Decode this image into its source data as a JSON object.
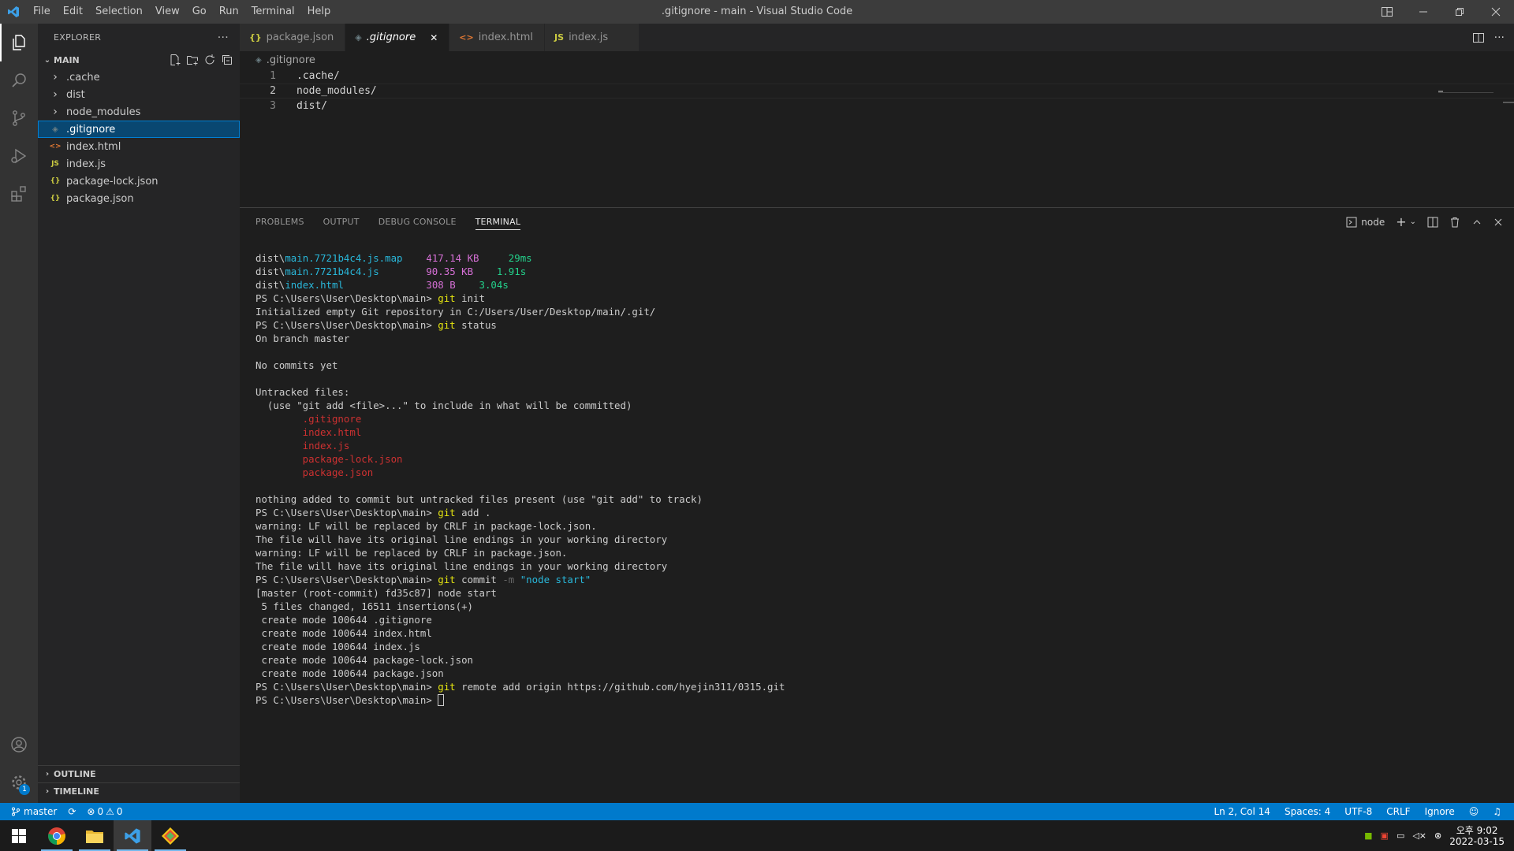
{
  "window": {
    "title": ".gitignore - main - Visual Studio Code",
    "menu": [
      "File",
      "Edit",
      "Selection",
      "View",
      "Go",
      "Run",
      "Terminal",
      "Help"
    ]
  },
  "sidebar": {
    "title": "EXPLORER",
    "section": "MAIN",
    "items": [
      {
        "label": ".cache",
        "type": "folder"
      },
      {
        "label": "dist",
        "type": "folder"
      },
      {
        "label": "node_modules",
        "type": "folder"
      },
      {
        "label": ".gitignore",
        "type": "gitignore",
        "selected": true
      },
      {
        "label": "index.html",
        "type": "html"
      },
      {
        "label": "index.js",
        "type": "js"
      },
      {
        "label": "package-lock.json",
        "type": "json"
      },
      {
        "label": "package.json",
        "type": "json"
      }
    ],
    "outline": "OUTLINE",
    "timeline": "TIMELINE"
  },
  "tabs": [
    {
      "label": "package.json",
      "icon": "{}",
      "active": false
    },
    {
      "label": ".gitignore",
      "icon": "◈",
      "active": true
    },
    {
      "label": "index.html",
      "icon": "<>",
      "active": false
    },
    {
      "label": "index.js",
      "icon": "JS",
      "active": false
    }
  ],
  "breadcrumb": ".gitignore",
  "code": [
    {
      "n": "1",
      "text": ".cache/"
    },
    {
      "n": "2",
      "text": "node_modules/"
    },
    {
      "n": "3",
      "text": "dist/"
    }
  ],
  "panel": {
    "tabs": [
      "PROBLEMS",
      "OUTPUT",
      "DEBUG CONSOLE",
      "TERMINAL"
    ],
    "active": "TERMINAL",
    "terminal_name": "node"
  },
  "terminal": [
    [
      [
        "dist\\",
        ""
      ],
      [
        "main.7721b4c4.js.map",
        "cy"
      ],
      [
        "    417.14 KB",
        "mg"
      ],
      [
        "     29ms",
        "gr"
      ]
    ],
    [
      [
        "dist\\",
        ""
      ],
      [
        "main.7721b4c4.js",
        "cy"
      ],
      [
        "        90.35 KB",
        "mg"
      ],
      [
        "    1.91s",
        "gr"
      ]
    ],
    [
      [
        "dist\\",
        ""
      ],
      [
        "index.html",
        "cy"
      ],
      [
        "              308 B",
        "mg"
      ],
      [
        "    3.04s",
        "gr"
      ]
    ],
    [
      [
        "PS C:\\Users\\User\\Desktop\\main> ",
        ""
      ],
      [
        "git",
        "y"
      ],
      [
        " init",
        ""
      ]
    ],
    [
      [
        "Initialized empty Git repository in C:/Users/User/Desktop/main/.git/",
        ""
      ]
    ],
    [
      [
        "PS C:\\Users\\User\\Desktop\\main> ",
        ""
      ],
      [
        "git",
        "y"
      ],
      [
        " status",
        ""
      ]
    ],
    [
      [
        "On branch master",
        ""
      ]
    ],
    [
      [
        "",
        ""
      ]
    ],
    [
      [
        "No commits yet",
        ""
      ]
    ],
    [
      [
        "",
        ""
      ]
    ],
    [
      [
        "Untracked files:",
        ""
      ]
    ],
    [
      [
        "  (use \"git add <file>...\" to include in what will be committed)",
        ""
      ]
    ],
    [
      [
        "        .gitignore",
        "rd"
      ]
    ],
    [
      [
        "        index.html",
        "rd"
      ]
    ],
    [
      [
        "        index.js",
        "rd"
      ]
    ],
    [
      [
        "        package-lock.json",
        "rd"
      ]
    ],
    [
      [
        "        package.json",
        "rd"
      ]
    ],
    [
      [
        "",
        ""
      ]
    ],
    [
      [
        "nothing added to commit but untracked files present (use \"git add\" to track)",
        ""
      ]
    ],
    [
      [
        "PS C:\\Users\\User\\Desktop\\main> ",
        ""
      ],
      [
        "git",
        "y"
      ],
      [
        " add .",
        ""
      ]
    ],
    [
      [
        "warning: LF will be replaced by CRLF in package-lock.json.",
        ""
      ]
    ],
    [
      [
        "The file will have its original line endings in your working directory",
        ""
      ]
    ],
    [
      [
        "warning: LF will be replaced by CRLF in package.json.",
        ""
      ]
    ],
    [
      [
        "The file will have its original line endings in your working directory",
        ""
      ]
    ],
    [
      [
        "PS C:\\Users\\User\\Desktop\\main> ",
        ""
      ],
      [
        "git",
        "y"
      ],
      [
        " commit ",
        ""
      ],
      [
        "-m",
        "gy"
      ],
      [
        " \"node start\"",
        "cy"
      ]
    ],
    [
      [
        "[master (root-commit) fd35c87] node start",
        ""
      ]
    ],
    [
      [
        " 5 files changed, 16511 insertions(+)",
        ""
      ]
    ],
    [
      [
        " create mode 100644 .gitignore",
        ""
      ]
    ],
    [
      [
        " create mode 100644 index.html",
        ""
      ]
    ],
    [
      [
        " create mode 100644 index.js",
        ""
      ]
    ],
    [
      [
        " create mode 100644 package-lock.json",
        ""
      ]
    ],
    [
      [
        " create mode 100644 package.json",
        ""
      ]
    ],
    [
      [
        "PS C:\\Users\\User\\Desktop\\main> ",
        ""
      ],
      [
        "git",
        "y"
      ],
      [
        " remote add origin https://github.com/hyejin311/0315.git",
        ""
      ]
    ],
    [
      [
        "PS C:\\Users\\User\\Desktop\\main> ",
        ""
      ],
      [
        "",
        "cursor"
      ]
    ]
  ],
  "status": {
    "branch": "master",
    "errors": "0",
    "warnings": "0",
    "position": "Ln 2, Col 14",
    "spaces": "Spaces: 4",
    "encoding": "UTF-8",
    "eol": "CRLF",
    "language": "Ignore",
    "settings_badge": "1"
  },
  "taskbar": {
    "time": "오후 9:02",
    "date": "2022-03-15"
  },
  "colors": {
    "accent": "#007acc",
    "selection": "#094771",
    "json_icon": "#cbcb41",
    "html_icon": "#e37933",
    "js_icon": "#cbcb41",
    "gitignore_icon": "#41535b"
  }
}
